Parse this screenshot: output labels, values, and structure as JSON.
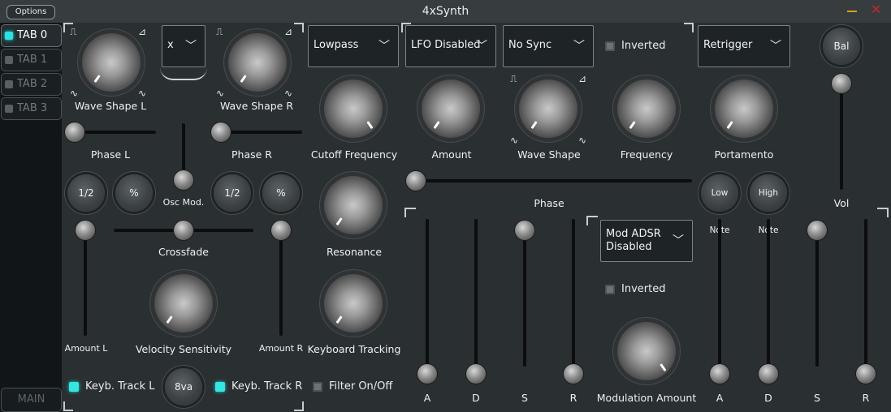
{
  "window": {
    "title": "4xSynth",
    "options_label": "Options",
    "close_glyph": "✕"
  },
  "tabs": [
    {
      "label": "TAB 0",
      "active": true
    },
    {
      "label": "TAB 1",
      "active": false
    },
    {
      "label": "TAB 2",
      "active": false
    },
    {
      "label": "TAB 3",
      "active": false
    }
  ],
  "main_button": "MAIN",
  "osc": {
    "wave_shape_l": "Wave Shape L",
    "wave_shape_r": "Wave Shape R",
    "mod_combo": "x",
    "phase_l": "Phase L",
    "phase_r": "Phase R",
    "half_l": "1/2",
    "pct_l": "%",
    "half_r": "1/2",
    "pct_r": "%",
    "osc_mod": "Osc Mod.",
    "crossfade": "Crossfade",
    "amount_l": "Amount L",
    "amount_r": "Amount R",
    "velocity_sensitivity": "Velocity Sensitivity",
    "keyb_track_l": "Keyb. Track L",
    "keyb_track_r": "Keyb. Track R",
    "octave_button": "8va"
  },
  "filter": {
    "type_combo": "Lowpass",
    "cutoff_frequency": "Cutoff Frequency",
    "resonance": "Resonance",
    "keyboard_tracking": "Keyboard Tracking",
    "filter_onoff": "Filter On/Off"
  },
  "lfo": {
    "mode_combo": "LFO Disabled",
    "sync_combo": "No Sync",
    "inverted": "Inverted",
    "amount": "Amount",
    "wave_shape": "Wave Shape",
    "frequency": "Frequency",
    "phase": "Phase"
  },
  "voice": {
    "retrigger_combo": "Retrigger",
    "portamento": "Portamento",
    "low_note": "Low Note",
    "high_note": "High Note",
    "bal": "Bal",
    "vol": "Vol"
  },
  "mod_adsr": {
    "combo_line1": "Mod ADSR",
    "combo_line2": "Disabled",
    "inverted": "Inverted",
    "modulation_amount": "Modulation Amount"
  },
  "adsr_left": {
    "a": "A",
    "d": "D",
    "s": "S",
    "r": "R"
  },
  "adsr_right": {
    "a": "A",
    "d": "D",
    "s": "S",
    "r": "R"
  },
  "icons": {
    "wave_square": "⎍",
    "wave_saw": "⊿",
    "wave_sine": "∿",
    "chevron": "﹀"
  },
  "colors": {
    "accent": "#2de0e0",
    "panel": "#2a2f32",
    "sidebar": "#111517"
  }
}
